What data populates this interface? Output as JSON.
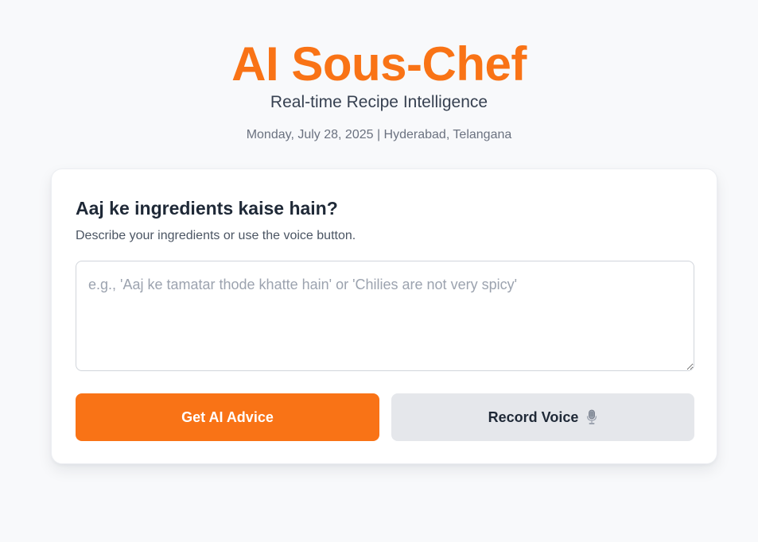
{
  "header": {
    "title": "AI Sous-Chef",
    "subtitle": "Real-time Recipe Intelligence",
    "date_location": "Monday, July 28, 2025 | Hyderabad, Telangana"
  },
  "card": {
    "title": "Aaj ke ingredients kaise hain?",
    "description": "Describe your ingredients or use the voice button.",
    "input": {
      "value": "",
      "placeholder": "e.g., 'Aaj ke tamatar thode khatte hain' or 'Chilies are not very spicy'"
    },
    "buttons": {
      "advice_label": "Get AI Advice",
      "voice_label": "Record Voice",
      "voice_icon": "microphone-icon"
    }
  },
  "colors": {
    "accent": "#f97316",
    "secondary_button": "#e5e7eb",
    "background": "#f8f9fb"
  }
}
